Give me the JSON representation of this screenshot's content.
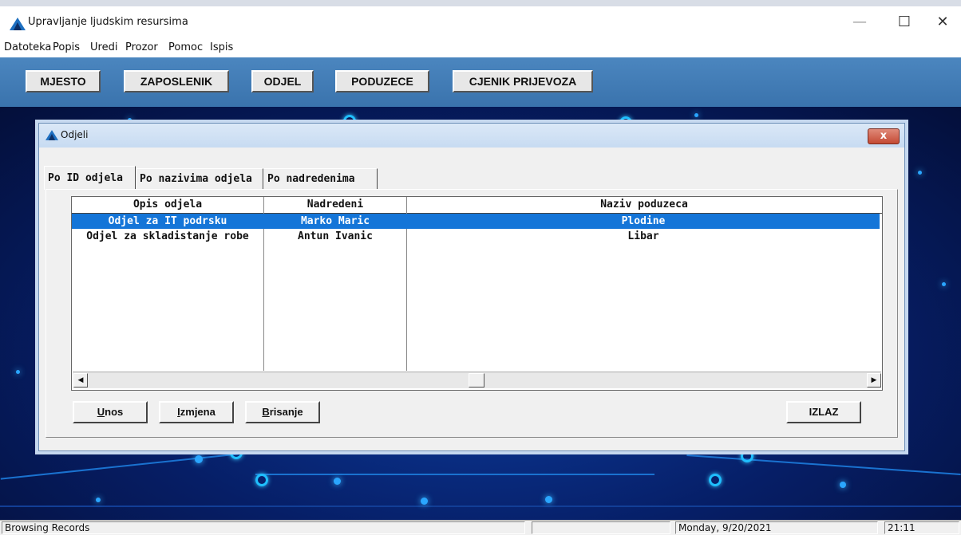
{
  "window": {
    "title": "Upravljanje ljudskim resursima",
    "minimize": "—",
    "maximize": "☐",
    "close": "✕"
  },
  "menu": [
    "Datoteka",
    "Popis",
    "Uredi",
    "Prozor",
    "Pomoc",
    "Ispis"
  ],
  "toolbar": {
    "buttons": [
      "MJESTO",
      "ZAPOSLENIK",
      "ODJEL",
      "PODUZECE",
      "CJENIK PRIJEVOZA"
    ]
  },
  "dialog": {
    "title": "Odjeli",
    "close": "x",
    "tabs": [
      "Po ID odjela",
      "Po nazivima odjela",
      "Po nadredenima"
    ],
    "active_tab": "Po ID odjela",
    "grid": {
      "columns": [
        "Opis odjela",
        "Nadredeni",
        "Naziv poduzeca"
      ],
      "rows": [
        {
          "opis": "Odjel za IT podrsku",
          "nadredeni": "Marko Maric",
          "poduzece": "Plodine",
          "selected": true
        },
        {
          "opis": "Odjel za skladistanje robe",
          "nadredeni": "Antun Ivanic",
          "poduzece": "Libar",
          "selected": false
        }
      ]
    },
    "buttons": {
      "unos": {
        "first": "U",
        "rest": "nos"
      },
      "izmjena": {
        "first": "I",
        "rest": "zmjena"
      },
      "brisanje": {
        "first": "B",
        "rest": "risanje"
      },
      "izlaz": "IZLAZ"
    }
  },
  "statusbar": {
    "message": "Browsing Records",
    "date": "Monday, 9/20/2021",
    "time": "21:11"
  },
  "colors": {
    "toolbar": "#3f7bb5",
    "selection": "#1475d8",
    "background": "#0a2a7a"
  }
}
